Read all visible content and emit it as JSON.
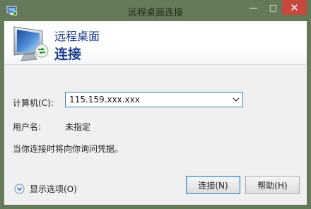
{
  "window": {
    "title": "远程桌面连接",
    "controls": {
      "minimize": "—",
      "maximize": "□",
      "close": "✕"
    }
  },
  "banner": {
    "line1": "远程桌面",
    "line2": "连接"
  },
  "form": {
    "computer_label": "计算机(C):",
    "computer_value": "115.159.xxx.xxx",
    "user_label": "用户名:",
    "user_value": "未指定",
    "prompt_text": "当你连接时将向你询问凭据。"
  },
  "footer": {
    "show_options_label": "显示选项(O)",
    "connect_label": "连接(N)",
    "help_label": "帮助(H)"
  },
  "colors": {
    "titlebar": "#657a5a",
    "close_button": "#c7483f",
    "banner_text": "#1a3c8c",
    "focus_border": "#3c7fb1"
  }
}
